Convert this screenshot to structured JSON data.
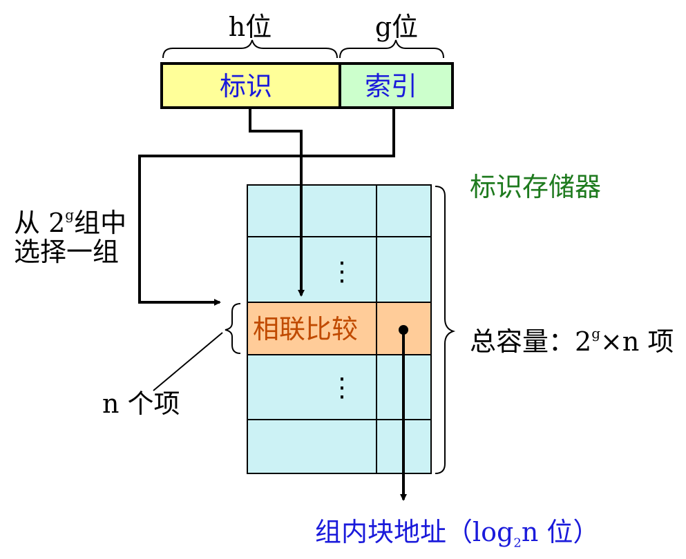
{
  "address": {
    "h_bits_label": "h位",
    "g_bits_label": "g位",
    "tag_field": "标识",
    "index_field": "索引"
  },
  "tag_memory": {
    "title": "标识存储器",
    "compare_row_label": "相联比较",
    "capacity_prefix": "总容量：2",
    "capacity_exp": "g",
    "capacity_suffix": "×n 项",
    "ellipsis": "⋮"
  },
  "select": {
    "line1_prefix": "从 2",
    "line1_exp": "g",
    "line1_suffix": "组中",
    "line2": "选择一组"
  },
  "n_items": "n 个项",
  "output": {
    "prefix": "组内块地址（log",
    "sub": "2",
    "suffix": "n 位）"
  },
  "colors": {
    "tag_fill": "#ffff99",
    "index_fill": "#ccffcc",
    "memory_fill": "#ccf2f5",
    "compare_fill": "#ffcc99",
    "blue_text": "#1a1adb",
    "green_text": "#1e7a1e"
  }
}
